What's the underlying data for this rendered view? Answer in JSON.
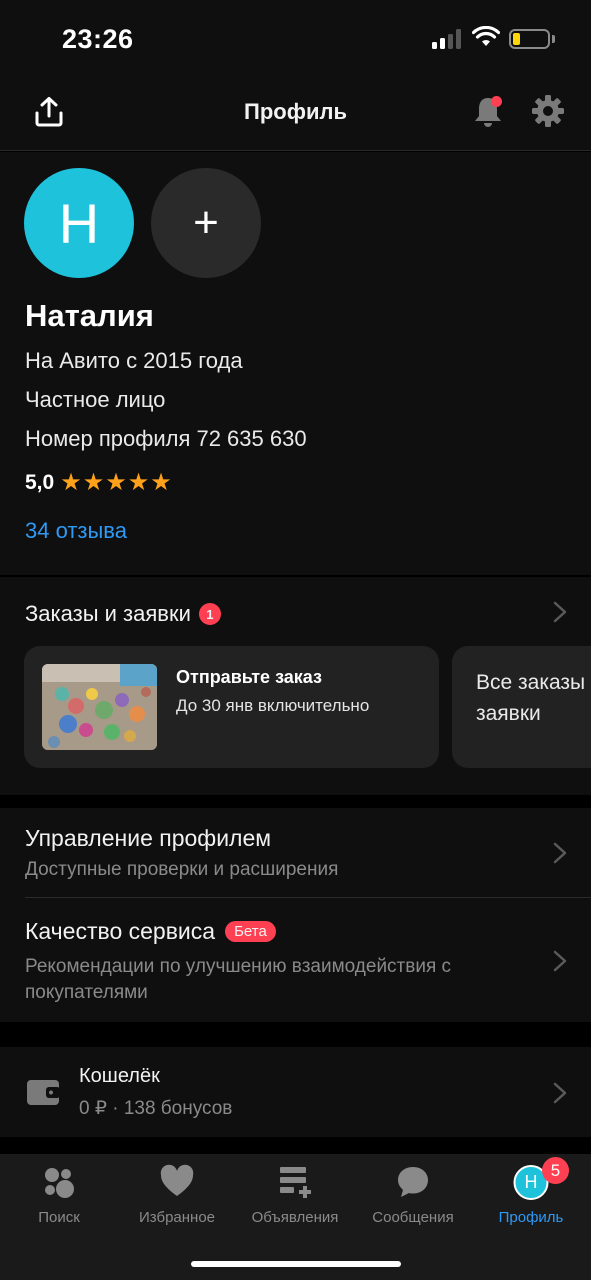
{
  "status_bar": {
    "time": "23:26"
  },
  "header": {
    "title": "Профиль"
  },
  "profile": {
    "avatar_letter": "Н",
    "add_symbol": "+",
    "name": "Наталия",
    "since": "На Авито с 2015 года",
    "type": "Частное лицо",
    "profile_number": "Номер профиля 72 635 630",
    "rating": "5,0",
    "stars": "★★★★★",
    "reviews": "34 отзыва"
  },
  "orders": {
    "title": "Заказы и заявки",
    "badge": "1",
    "card_title": "Отправьте заказ",
    "card_subtitle": "До 30 янв включительно",
    "all_label": "Все заказы и заявки"
  },
  "management": {
    "profile_title": "Управление профилем",
    "profile_subtitle": "Доступные проверки и расширения",
    "quality_title": "Качество сервиса",
    "quality_badge": "Бета",
    "quality_subtitle": "Рекомендации по улучшению взаимодействия с покупателями"
  },
  "wallet": {
    "title": "Кошелёк",
    "subtitle": "0 ₽ · 138 бонусов"
  },
  "tabbar": {
    "search": "Поиск",
    "favorites": "Избранное",
    "ads": "Объявления",
    "messages": "Сообщения",
    "profile": "Профиль",
    "profile_avatar": "Н",
    "profile_badge": "5"
  },
  "colors": {
    "accent": "#2e9af5",
    "avatar": "#1ec2db",
    "badge": "#ff4053",
    "star": "#ffa11a"
  }
}
